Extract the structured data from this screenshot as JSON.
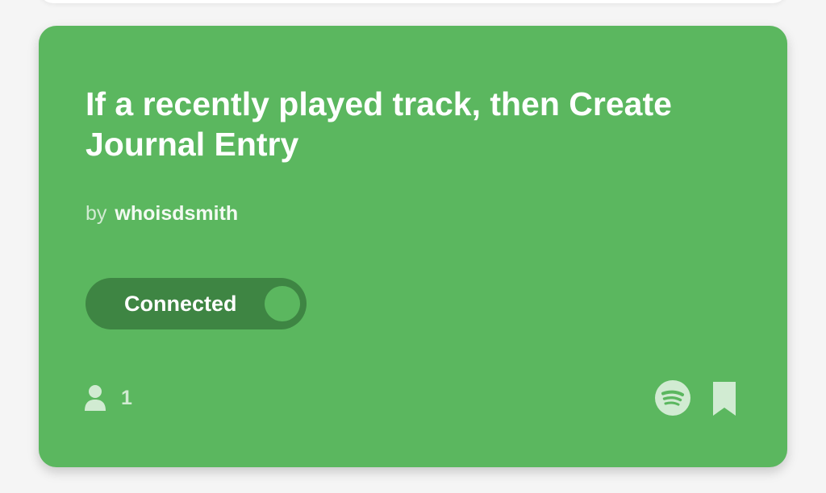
{
  "applet": {
    "title": "If a recently played track, then Create Journal Entry",
    "byline_prefix": "by",
    "author": "whoisdsmith",
    "toggle_label": "Connected",
    "toggle_state": "on",
    "users_count": "1",
    "service_icon": "spotify-icon",
    "bookmark_icon": "bookmark-icon",
    "user_icon": "person-icon"
  },
  "colors": {
    "card_background": "#5bb75f",
    "toggle_background": "#3e8543",
    "page_background": "#f5f5f5",
    "text": "#ffffff"
  }
}
